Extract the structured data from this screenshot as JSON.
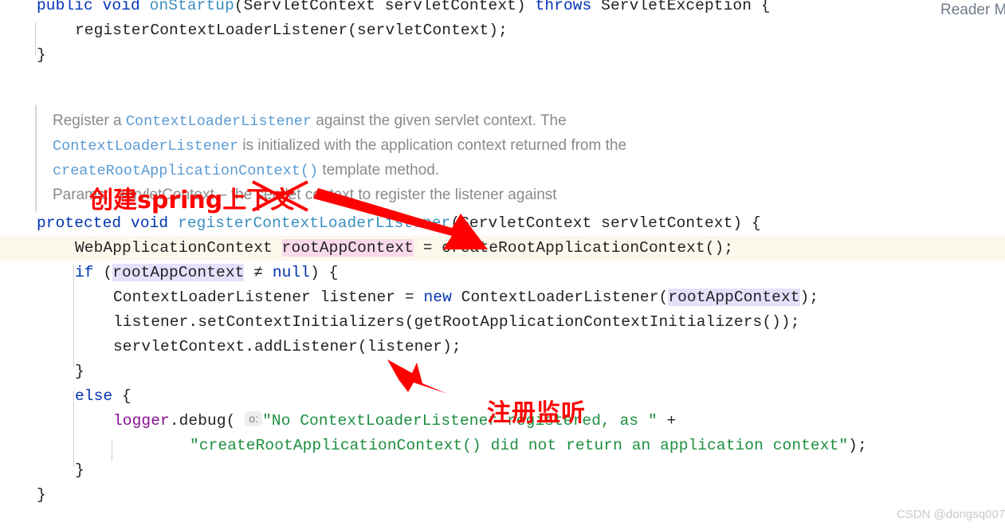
{
  "editor": {
    "reader_mode_label": "Reader M",
    "watermark": "CSDN @dongsq007",
    "param_hint": "o:",
    "colors": {
      "keyword": "#0033b3",
      "method": "#3a8fbf",
      "string": "#1d8f3f",
      "logger": "#871094",
      "doc_link": "#5b9bd5",
      "doc_text": "#8a8a8a",
      "current_line_bg": "#fcf9ec",
      "declaration_highlight": "#f9d9ea",
      "usage_highlight": "#e4e2fb",
      "annotation_red": "#fe0000"
    }
  },
  "code": {
    "l1_kw1": "public",
    "l1_kw2": "void",
    "l1_method": "onStartup",
    "l1_rest": "(ServletContext servletContext) ",
    "l1_kw3": "throws",
    "l1_tail": " ServletException {",
    "l2": "registerContextLoaderListener(servletContext);",
    "l3": "}",
    "l5_kw1": "protected",
    "l5_kw2": "void",
    "l5_method": "registerContextLoaderListener",
    "l5_rest": "(ServletContext servletContext) {",
    "l6_pre": "WebApplicationContext ",
    "l6_var": "rootAppContext",
    "l6_post": " = createRootApplicationContext();",
    "l7_kw": "if",
    "l7_a": " (",
    "l7_var": "rootAppContext",
    "l7_b": " ≠ ",
    "l7_null": "null",
    "l7_c": ") {",
    "l8_pre": "ContextLoaderListener listener = ",
    "l8_new": "new",
    "l8_mid": " ContextLoaderListener(",
    "l8_var": "rootAppContext",
    "l8_post": ");",
    "l9": "listener.setContextInitializers(getRootApplicationContextInitializers());",
    "l10": "servletContext.addListener(listener);",
    "l11": "}",
    "l12_kw": "else",
    "l12_rest": " {",
    "l13_logger": "logger",
    "l13_dot": ".debug( ",
    "l13_str": "\"No ContextLoaderListener registered, as \"",
    "l13_plus": " +",
    "l14_str": "\"createRootApplicationContext() did not return an application context\"",
    "l14_tail": ");",
    "l15": "}",
    "l16": "}"
  },
  "doc": {
    "line1_a": "Register a ",
    "line1_link": "ContextLoaderListener",
    "line1_b": " against the given servlet context. The",
    "line2_link": "ContextLoaderListener",
    "line2_b": " is initialized with the application context returned from the",
    "line3_link": "createRootApplicationContext()",
    "line3_b": " template method.",
    "line4": "Params:  servletContext – the servlet context to register the listener against"
  },
  "annotations": [
    {
      "text": "创建spring上下文"
    },
    {
      "text": "注册监听"
    }
  ]
}
